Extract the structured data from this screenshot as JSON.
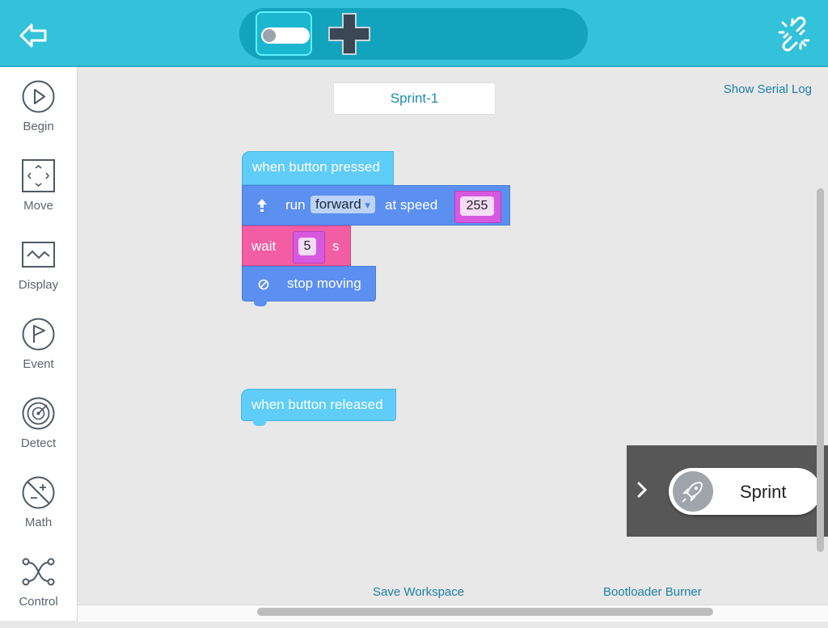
{
  "sidebar": {
    "items": [
      {
        "label": "Begin",
        "icon": "play-icon"
      },
      {
        "label": "Move",
        "icon": "move-icon"
      },
      {
        "label": "Display",
        "icon": "display-icon"
      },
      {
        "label": "Event",
        "icon": "flag-icon"
      },
      {
        "label": "Detect",
        "icon": "radar-icon"
      },
      {
        "label": "Math",
        "icon": "math-icon"
      },
      {
        "label": "Control",
        "icon": "control-icon"
      }
    ]
  },
  "workspace": {
    "title": "Sprint-1",
    "serial_log_label": "Show Serial Log",
    "save_label": "Save Workspace",
    "bootloader_label": "Bootloader Burner"
  },
  "blocks": {
    "hat_pressed": "when button pressed",
    "run_label": "run",
    "direction": "forward",
    "dropdown_arrow": "▾",
    "at_speed_label": "at speed",
    "speed": "255",
    "wait_label": "wait",
    "wait_value": "5",
    "wait_unit": "s",
    "stop_label": "stop moving",
    "hat_released": "when button released"
  },
  "run_panel": {
    "button_label": "Sprint"
  },
  "colors": {
    "topbar": "#33c2d9",
    "hat_block": "#5fcdf8",
    "motion_block": "#5b8ff0",
    "wait_block": "#f25da4",
    "number_slot": "#d659e0",
    "link": "#1b7fa6"
  }
}
